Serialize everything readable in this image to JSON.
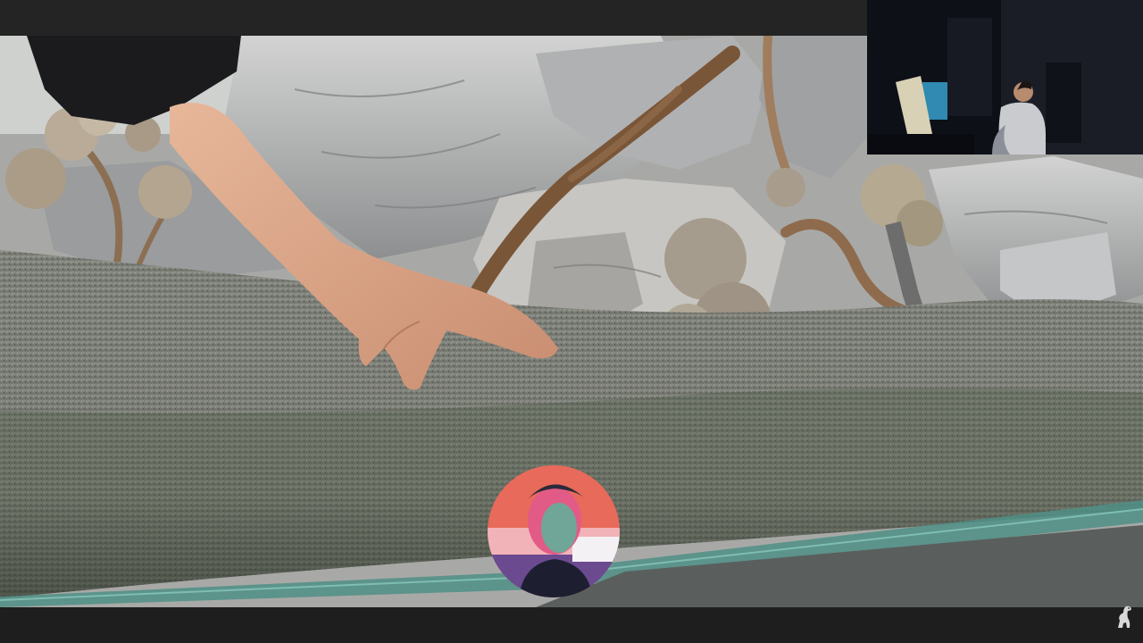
{
  "scene": {
    "description_visible_text": "",
    "colors": {
      "substrate": "#7c7f78",
      "rock": "#b7b9ba",
      "driftwood": "#7a5638",
      "glass_rim": "#4f8f86",
      "background_bars": "#242424"
    }
  },
  "overlays": {
    "webcam": {
      "label": ""
    },
    "facecam": {
      "label": ""
    },
    "logo": {
      "icon": "dinosaur-logo-icon"
    }
  }
}
